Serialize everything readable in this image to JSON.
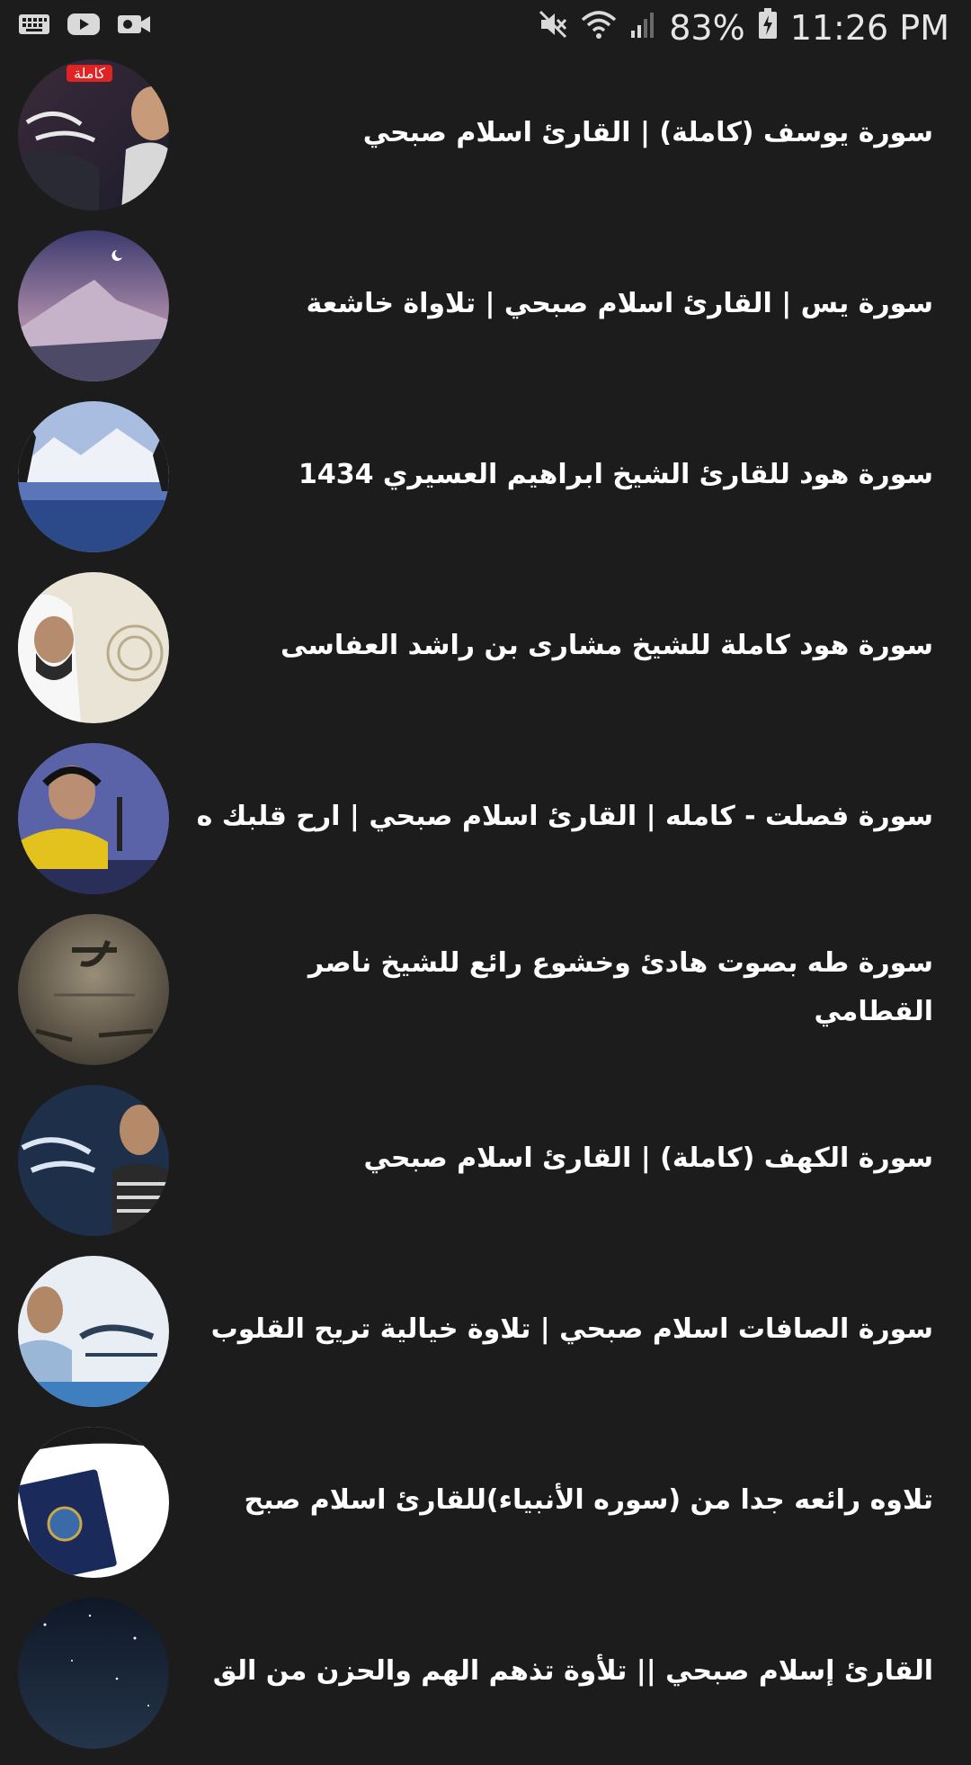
{
  "status_bar": {
    "battery": "83%",
    "time": "11:26 PM",
    "left_icons": [
      "keyboard-icon",
      "youtube-icon",
      "video-camera-icon"
    ],
    "right_icons": [
      "mute-icon",
      "wifi-icon",
      "signal-icon",
      "battery-charging-icon"
    ]
  },
  "videos": [
    {
      "title": "سورة يوسف (كاملة) | القارئ اسلام صبحي",
      "badge": "كاملة"
    },
    {
      "title": "سورة يس | القارئ اسلام صبحي | تلاواة خاشعة"
    },
    {
      "title": "سورة هود للقارئ الشيخ ابراهيم العسيري 1434"
    },
    {
      "title": "سورة هود كاملة للشيخ مشارى بن راشد العفاسى"
    },
    {
      "title": "سورة فصلت - كامله | القارئ اسلام صبحي | ارح قلبك ه"
    },
    {
      "title": "سورة طه بصوت هادئ وخشوع رائع للشيخ ناصر القطامي"
    },
    {
      "title": "سورة الكهف (كاملة) | القارئ اسلام صبحي"
    },
    {
      "title": "سورة الصافات اسلام صبحي | تلاوة خيالية تريح القلوب"
    },
    {
      "title": "تلاوه رائعه جدا من (سوره الأنبياء)للقارئ اسلام صبح"
    },
    {
      "title": "القارئ إسلام صبحي || تلأوة تذهم الهم والحزن من الق"
    }
  ],
  "colors": {
    "background": "#1c1c1c",
    "text": "#ffffff",
    "badge": "#e02424"
  }
}
